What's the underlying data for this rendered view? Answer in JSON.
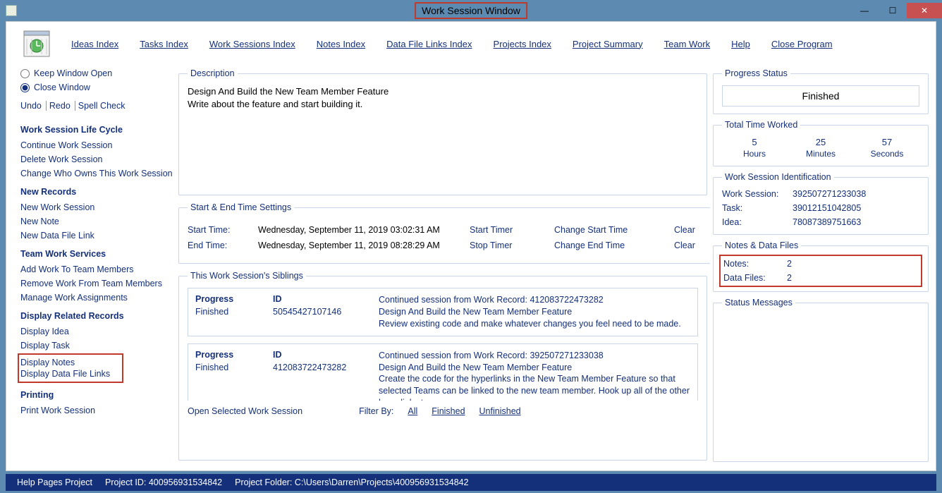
{
  "window": {
    "title": "Work Session Window"
  },
  "toolbar": {
    "ideas": "Ideas Index",
    "tasks": "Tasks Index",
    "worksessions": "Work Sessions Index",
    "notes": "Notes Index",
    "datafiles": "Data File Links Index",
    "projects": "Projects Index",
    "summary": "Project Summary",
    "teamwork": "Team Work",
    "help": "Help",
    "close": "Close Program"
  },
  "sidebar": {
    "keepOpen": "Keep Window Open",
    "closeWin": "Close Window",
    "undo": "Undo",
    "redo": "Redo",
    "spell": "Spell Check",
    "lifecycle": {
      "title": "Work Session Life Cycle",
      "continue": "Continue Work Session",
      "delete": "Delete Work Session",
      "changeOwner": "Change Who Owns This Work Session"
    },
    "newrec": {
      "title": "New Records",
      "newWS": "New Work Session",
      "newNote": "New Note",
      "newDFL": "New Data File Link"
    },
    "teamwork": {
      "title": "Team Work Services",
      "addWork": "Add Work To Team Members",
      "removeWork": "Remove Work From Team Members",
      "manage": "Manage Work Assignments"
    },
    "related": {
      "title": "Display Related Records",
      "idea": "Display Idea",
      "task": "Display Task",
      "notes": "Display Notes",
      "dfl": "Display Data File Links"
    },
    "printing": {
      "title": "Printing",
      "print": "Print Work Session"
    }
  },
  "description": {
    "legend": "Description",
    "line1": "Design And Build the New Team Member Feature",
    "line2": "Write about the feature and start building it."
  },
  "times": {
    "legend": "Start & End Time Settings",
    "startLabel": "Start Time:",
    "startVal": "Wednesday, September 11, 2019   03:02:31 AM",
    "startTimer": "Start Timer",
    "changeStart": "Change Start Time",
    "clear1": "Clear",
    "endLabel": "End Time:",
    "endVal": "Wednesday, September 11, 2019   08:28:29 AM",
    "stopTimer": "Stop Timer",
    "changeEnd": "Change End Time",
    "clear2": "Clear"
  },
  "siblings": {
    "legend": "This Work Session's Siblings",
    "progressHdr": "Progress",
    "idHdr": "ID",
    "rows": [
      {
        "progress": "Finished",
        "id": "50545427107146",
        "d1": "Continued session from Work Record: 412083722473282",
        "d2": "Design And Build the New Team Member Feature",
        "d3": "Review existing code and make whatever changes you feel need to be made."
      },
      {
        "progress": "Finished",
        "id": "412083722473282",
        "d1": "Continued session from Work Record: 392507271233038",
        "d2": "Design And Build the New Team Member Feature",
        "d3": "Create the code for the hyperlinks in the New Team Member Feature so that selected Teams can be linked to the new team member. Hook up all of the other hyperlinks to"
      }
    ],
    "openSel": "Open Selected Work Session",
    "filterBy": "Filter By:",
    "all": "All",
    "finished": "Finished",
    "unfinished": "Unfinished"
  },
  "right": {
    "progStatus": {
      "legend": "Progress Status",
      "value": "Finished"
    },
    "timeWorked": {
      "legend": "Total Time Worked",
      "h": "5",
      "hLabel": "Hours",
      "m": "25",
      "mLabel": "Minutes",
      "s": "57",
      "sLabel": "Seconds"
    },
    "ident": {
      "legend": "Work Session Identification",
      "wsL": "Work Session:",
      "wsV": "392507271233038",
      "taskL": "Task:",
      "taskV": "39012151042805",
      "ideaL": "Idea:",
      "ideaV": "78087389751663"
    },
    "notes": {
      "legend": "Notes & Data Files",
      "notesL": "Notes:",
      "notesV": "2",
      "dfL": "Data Files:",
      "dfV": "2"
    },
    "statusMsgs": {
      "legend": "Status Messages"
    }
  },
  "footer": {
    "help": "Help Pages Project",
    "pid": "Project ID:  400956931534842",
    "folder": "Project Folder:  C:\\Users\\Darren\\Projects\\400956931534842"
  }
}
